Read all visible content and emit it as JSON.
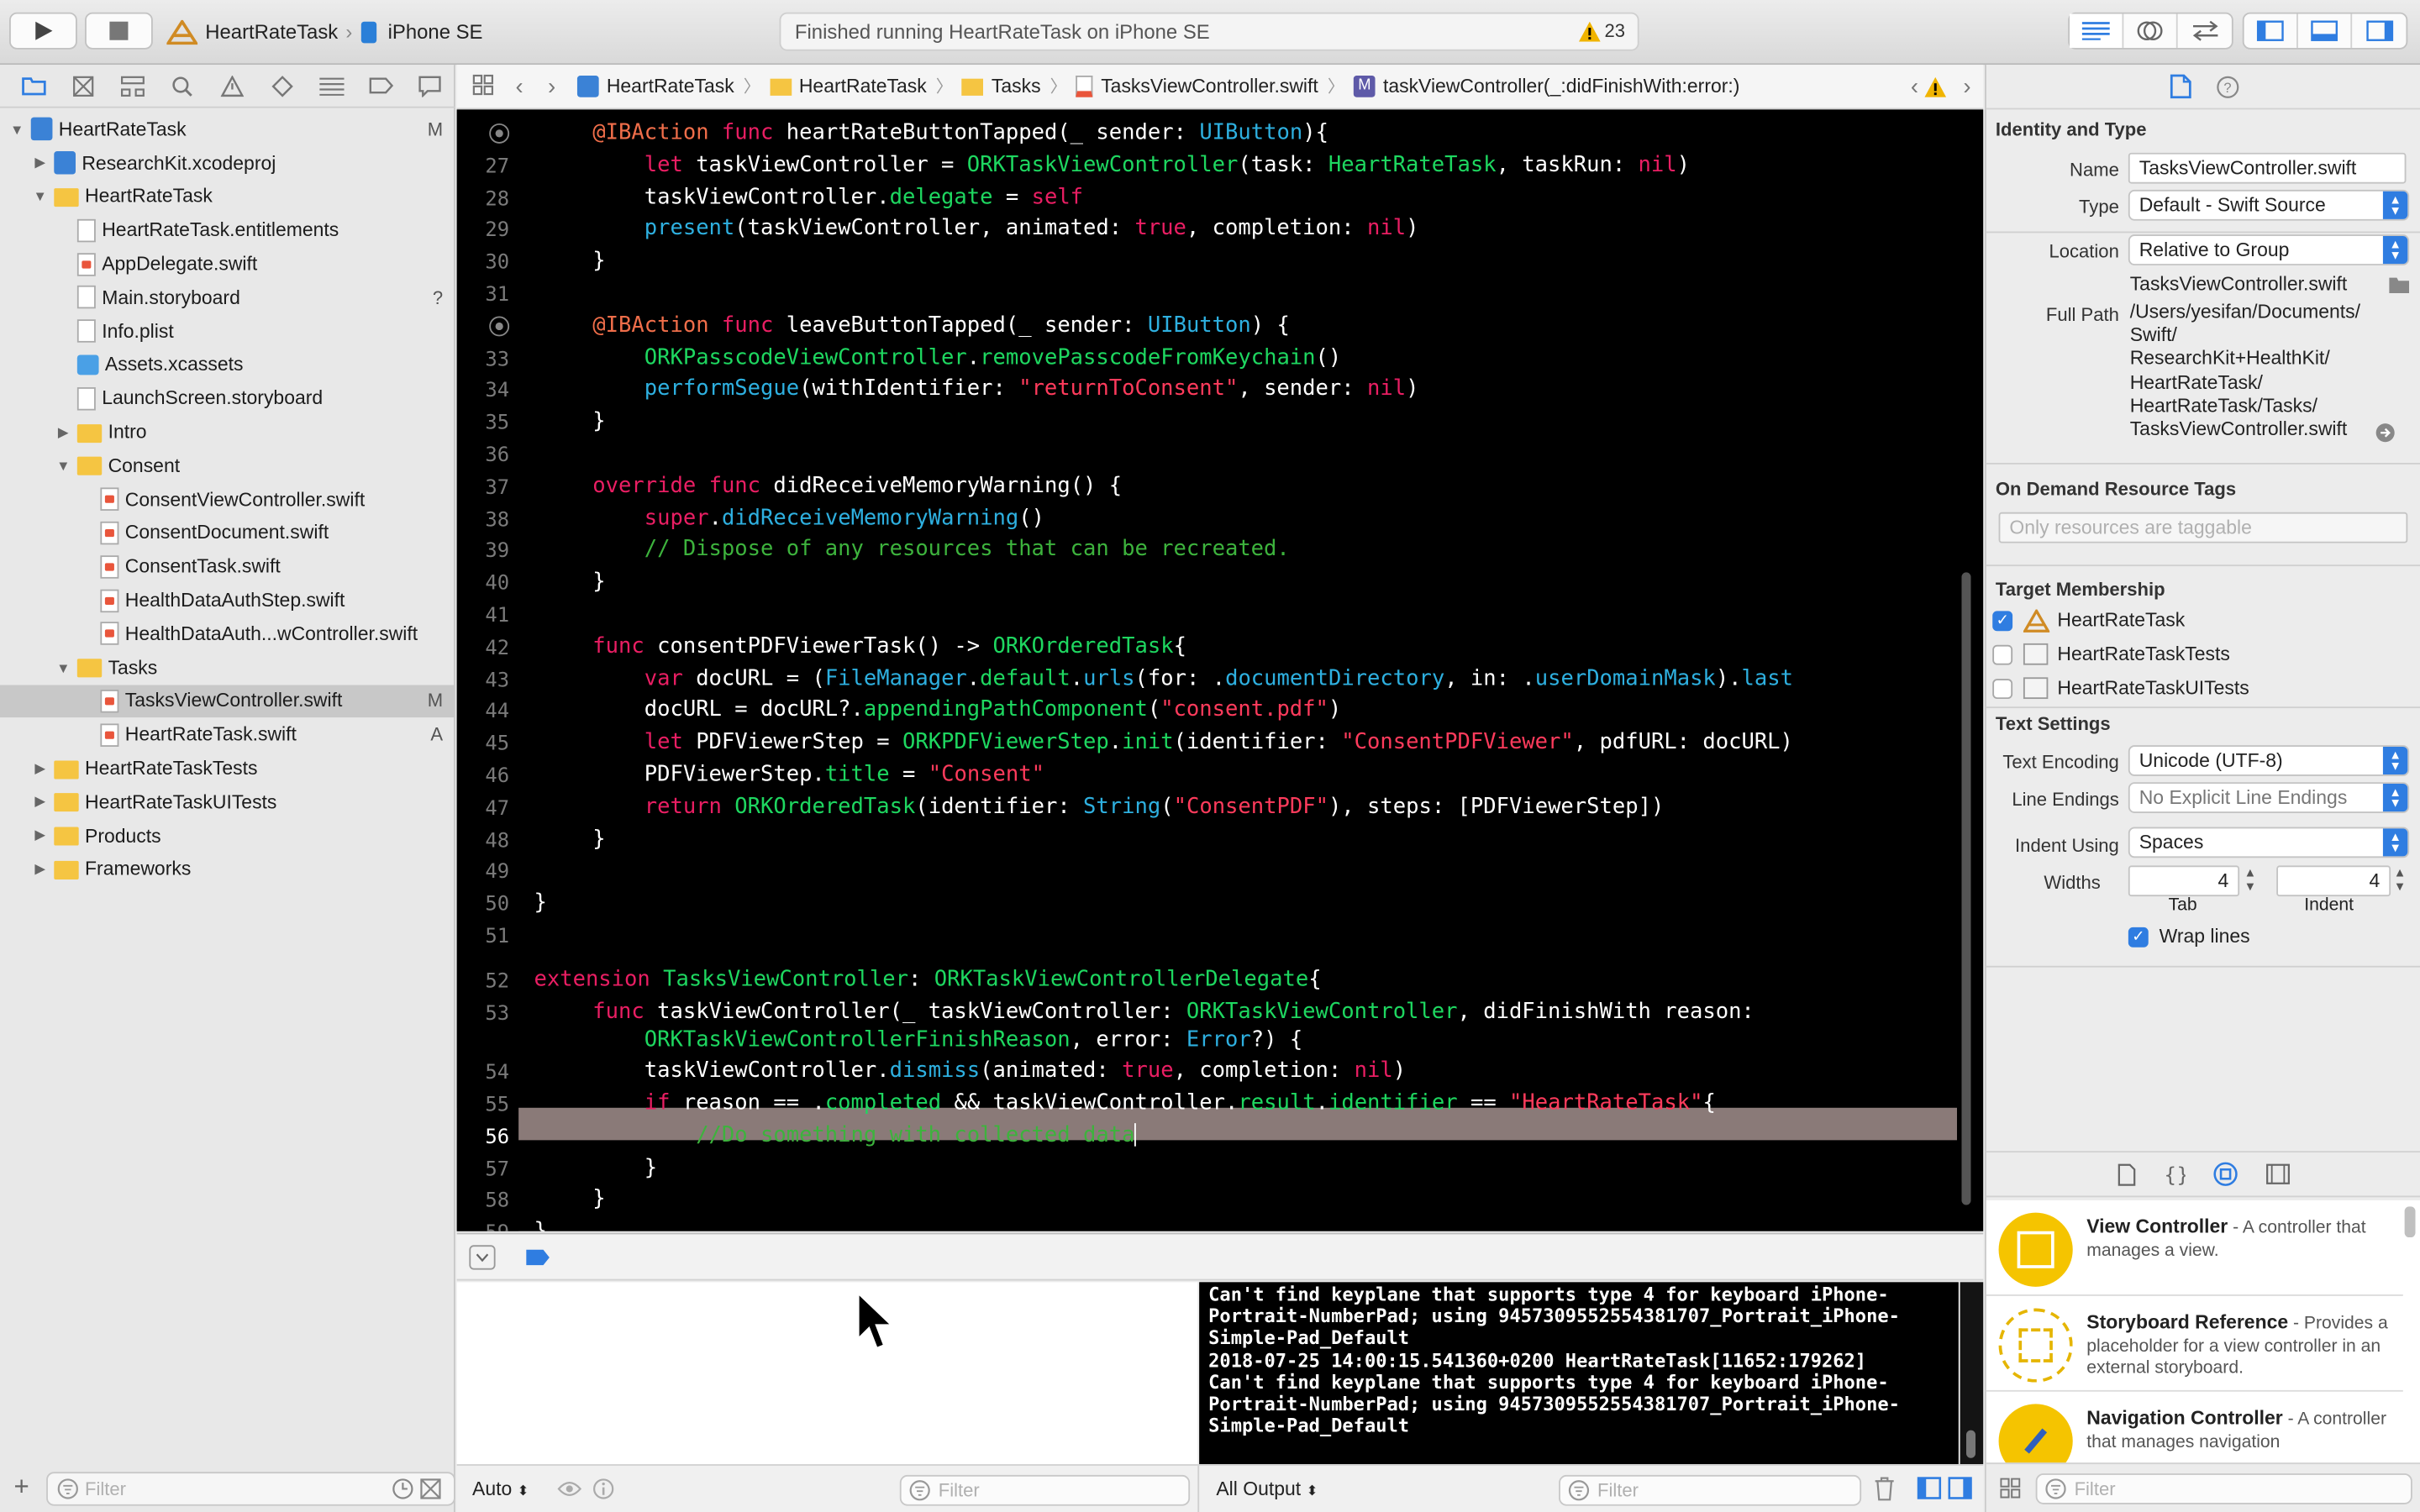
{
  "toolbar": {
    "scheme_name": "HeartRateTask",
    "device_name": "iPhone SE",
    "activity_status": "Finished running HeartRateTask on iPhone SE",
    "warning_count": "23"
  },
  "navigator": {
    "items": [
      {
        "label": "HeartRateTask",
        "status": "M",
        "indent": 0,
        "icon": "project-icon",
        "tri": "▼"
      },
      {
        "label": "ResearchKit.xcodeproj",
        "status": "",
        "indent": 1,
        "icon": "project-icon",
        "tri": "▶"
      },
      {
        "label": "HeartRateTask",
        "status": "",
        "indent": 1,
        "icon": "folder-icon",
        "tri": "▼"
      },
      {
        "label": "HeartRateTask.entitlements",
        "status": "",
        "indent": 2,
        "icon": "file-icon",
        "tri": ""
      },
      {
        "label": "AppDelegate.swift",
        "status": "",
        "indent": 2,
        "icon": "swift-file-icon",
        "tri": ""
      },
      {
        "label": "Main.storyboard",
        "status": "?",
        "indent": 2,
        "icon": "file-icon",
        "tri": ""
      },
      {
        "label": "Info.plist",
        "status": "",
        "indent": 2,
        "icon": "file-icon",
        "tri": ""
      },
      {
        "label": "Assets.xcassets",
        "status": "",
        "indent": 2,
        "icon": "assets-icon",
        "tri": ""
      },
      {
        "label": "LaunchScreen.storyboard",
        "status": "",
        "indent": 2,
        "icon": "file-icon",
        "tri": ""
      },
      {
        "label": "Intro",
        "status": "",
        "indent": 2,
        "icon": "folder-icon",
        "tri": "▶"
      },
      {
        "label": "Consent",
        "status": "",
        "indent": 2,
        "icon": "folder-icon",
        "tri": "▼"
      },
      {
        "label": "ConsentViewController.swift",
        "status": "",
        "indent": 3,
        "icon": "swift-file-icon",
        "tri": ""
      },
      {
        "label": "ConsentDocument.swift",
        "status": "",
        "indent": 3,
        "icon": "swift-file-icon",
        "tri": ""
      },
      {
        "label": "ConsentTask.swift",
        "status": "",
        "indent": 3,
        "icon": "swift-file-icon",
        "tri": ""
      },
      {
        "label": "HealthDataAuthStep.swift",
        "status": "",
        "indent": 3,
        "icon": "swift-file-icon",
        "tri": ""
      },
      {
        "label": "HealthDataAuth...wController.swift",
        "status": "",
        "indent": 3,
        "icon": "swift-file-icon",
        "tri": ""
      },
      {
        "label": "Tasks",
        "status": "",
        "indent": 2,
        "icon": "folder-icon",
        "tri": "▼"
      },
      {
        "label": "TasksViewController.swift",
        "status": "M",
        "indent": 3,
        "icon": "swift-file-icon",
        "tri": "",
        "selected": true
      },
      {
        "label": "HeartRateTask.swift",
        "status": "A",
        "indent": 3,
        "icon": "swift-file-icon",
        "tri": ""
      },
      {
        "label": "HeartRateTaskTests",
        "status": "",
        "indent": 1,
        "icon": "folder-icon",
        "tri": "▶"
      },
      {
        "label": "HeartRateTaskUITests",
        "status": "",
        "indent": 1,
        "icon": "folder-icon",
        "tri": "▶"
      },
      {
        "label": "Products",
        "status": "",
        "indent": 1,
        "icon": "folder-icon",
        "tri": "▶"
      },
      {
        "label": "Frameworks",
        "status": "",
        "indent": 1,
        "icon": "folder-icon",
        "tri": "▶"
      }
    ],
    "filter_placeholder": "Filter"
  },
  "jumpbar": {
    "crumbs": [
      "HeartRateTask",
      "HeartRateTask",
      "Tasks",
      "TasksViewController.swift",
      "taskViewController(_:didFinishWith:error:)"
    ]
  },
  "editor": {
    "lines": [
      {
        "n": "",
        "bp": true,
        "parts": [
          [
            "at",
            "@IBAction "
          ],
          [
            "kw",
            "func "
          ],
          [
            "",
            "heartRateButtonTapped(_ sender: "
          ],
          [
            "fn",
            "UIButton"
          ],
          [
            "",
            "){"
          ]
        ]
      },
      {
        "n": "27",
        "parts": [
          [
            "",
            "    "
          ],
          [
            "kw",
            "let "
          ],
          [
            "",
            "taskViewController = "
          ],
          [
            "ty",
            "ORKTaskViewController"
          ],
          [
            "",
            "(task: "
          ],
          [
            "ty",
            "HeartRateTask"
          ],
          [
            "",
            ", taskRun: "
          ],
          [
            "kw",
            "nil"
          ],
          [
            "",
            ")"
          ]
        ]
      },
      {
        "n": "28",
        "parts": [
          [
            "",
            "    taskViewController."
          ],
          [
            "ty",
            "delegate"
          ],
          [
            "",
            " = "
          ],
          [
            "kw",
            "self"
          ]
        ]
      },
      {
        "n": "29",
        "parts": [
          [
            "",
            "    "
          ],
          [
            "fn",
            "present"
          ],
          [
            "",
            "(taskViewController, animated: "
          ],
          [
            "kw",
            "true"
          ],
          [
            "",
            ", completion: "
          ],
          [
            "kw",
            "nil"
          ],
          [
            "",
            ")"
          ]
        ]
      },
      {
        "n": "30",
        "parts": [
          [
            "",
            "}"
          ]
        ]
      },
      {
        "n": "31",
        "parts": []
      },
      {
        "n": "",
        "bp": true,
        "parts": [
          [
            "at",
            "@IBAction "
          ],
          [
            "kw",
            "func "
          ],
          [
            "",
            "leaveButtonTapped(_ sender: "
          ],
          [
            "fn",
            "UIButton"
          ],
          [
            "",
            ") {"
          ]
        ]
      },
      {
        "n": "33",
        "parts": [
          [
            "",
            "    "
          ],
          [
            "ty",
            "ORKPasscodeViewController"
          ],
          [
            "",
            "."
          ],
          [
            "ty",
            "removePasscodeFromKeychain"
          ],
          [
            "",
            "()"
          ]
        ]
      },
      {
        "n": "34",
        "parts": [
          [
            "",
            "    "
          ],
          [
            "fn",
            "performSegue"
          ],
          [
            "",
            "(withIdentifier: "
          ],
          [
            "st",
            "\"returnToConsent\""
          ],
          [
            "",
            ", sender: "
          ],
          [
            "kw",
            "nil"
          ],
          [
            "",
            ")"
          ]
        ]
      },
      {
        "n": "35",
        "parts": [
          [
            "",
            "}"
          ]
        ]
      },
      {
        "n": "36",
        "parts": []
      },
      {
        "n": "37",
        "parts": [
          [
            "kw",
            "override "
          ],
          [
            "kw",
            "func "
          ],
          [
            "",
            "didReceiveMemoryWarning() {"
          ]
        ]
      },
      {
        "n": "38",
        "parts": [
          [
            "",
            "    "
          ],
          [
            "kw",
            "super"
          ],
          [
            "",
            "."
          ],
          [
            "fn",
            "didReceiveMemoryWarning"
          ],
          [
            "",
            "()"
          ]
        ]
      },
      {
        "n": "39",
        "parts": [
          [
            "cm",
            "    // Dispose of any resources that can be recreated."
          ]
        ]
      },
      {
        "n": "40",
        "parts": [
          [
            "",
            "}"
          ]
        ]
      },
      {
        "n": "41",
        "parts": []
      },
      {
        "n": "42",
        "parts": [
          [
            "kw",
            "func "
          ],
          [
            "",
            "consentPDFViewerTask() -> "
          ],
          [
            "ty",
            "ORKOrderedTask"
          ],
          [
            "",
            "{"
          ]
        ]
      },
      {
        "n": "43",
        "parts": [
          [
            "",
            "    "
          ],
          [
            "kw",
            "var "
          ],
          [
            "",
            "docURL = ("
          ],
          [
            "fn",
            "FileManager"
          ],
          [
            "",
            "."
          ],
          [
            "ty",
            "default"
          ],
          [
            "",
            "."
          ],
          [
            "fn",
            "urls"
          ],
          [
            "",
            "(for: ."
          ],
          [
            "fn",
            "documentDirectory"
          ],
          [
            "",
            ", in: ."
          ],
          [
            "fn",
            "userDomainMask"
          ],
          [
            "",
            ")."
          ],
          [
            "fn",
            "last"
          ]
        ]
      },
      {
        "n": "44",
        "parts": [
          [
            "",
            "    docURL = docURL?."
          ],
          [
            "ty",
            "appendingPathComponent"
          ],
          [
            "",
            "("
          ],
          [
            "st",
            "\"consent.pdf\""
          ],
          [
            "",
            ")"
          ]
        ]
      },
      {
        "n": "45",
        "parts": [
          [
            "",
            "    "
          ],
          [
            "kw",
            "let "
          ],
          [
            "",
            "PDFViewerStep = "
          ],
          [
            "ty",
            "ORKPDFViewerStep"
          ],
          [
            "",
            "."
          ],
          [
            "ty",
            "init"
          ],
          [
            "",
            "(identifier: "
          ],
          [
            "st",
            "\"ConsentPDFViewer\""
          ],
          [
            "",
            ", pdfURL: docURL)"
          ]
        ]
      },
      {
        "n": "46",
        "parts": [
          [
            "",
            "    PDFViewerStep."
          ],
          [
            "ty",
            "title"
          ],
          [
            "",
            " = "
          ],
          [
            "st",
            "\"Consent\""
          ]
        ]
      },
      {
        "n": "47",
        "parts": [
          [
            "",
            "    "
          ],
          [
            "kw",
            "return "
          ],
          [
            "ty",
            "ORKOrderedTask"
          ],
          [
            "",
            "(identifier: "
          ],
          [
            "fn",
            "String"
          ],
          [
            "",
            "("
          ],
          [
            "st",
            "\"ConsentPDF\""
          ],
          [
            "",
            "), steps: [PDFViewerStep])"
          ]
        ]
      },
      {
        "n": "48",
        "parts": [
          [
            "",
            "}"
          ]
        ]
      },
      {
        "n": "49",
        "parts": []
      },
      {
        "n": "50",
        "indent0": true,
        "parts": [
          [
            "",
            "}"
          ]
        ]
      },
      {
        "n": "51",
        "parts": []
      },
      {
        "n": "52",
        "indent0": true,
        "parts": [
          [
            "kw",
            "extension "
          ],
          [
            "ty",
            "TasksViewController"
          ],
          [
            "",
            ": "
          ],
          [
            "ty",
            "ORKTaskViewControllerDelegate"
          ],
          [
            "",
            "{"
          ]
        ]
      },
      {
        "n": "53",
        "parts": [
          [
            "kw",
            "func "
          ],
          [
            "",
            "taskViewController(_ taskViewController: "
          ],
          [
            "ty",
            "ORKTaskViewController"
          ],
          [
            "",
            ", didFinishWith reason:"
          ]
        ]
      },
      {
        "n": "",
        "parts": [
          [
            "",
            "    "
          ],
          [
            "ty",
            "ORKTaskViewControllerFinishReason"
          ],
          [
            "",
            ", error: "
          ],
          [
            "fn",
            "Error"
          ],
          [
            "",
            "?) {"
          ]
        ]
      },
      {
        "n": "54",
        "parts": [
          [
            "",
            "    taskViewController."
          ],
          [
            "fn",
            "dismiss"
          ],
          [
            "",
            "(animated: "
          ],
          [
            "kw",
            "true"
          ],
          [
            "",
            ", completion: "
          ],
          [
            "kw",
            "nil"
          ],
          [
            "",
            ")"
          ]
        ]
      },
      {
        "n": "55",
        "parts": [
          [
            "",
            "    "
          ],
          [
            "kw",
            "if "
          ],
          [
            "",
            "reason == ."
          ],
          [
            "ty",
            "completed"
          ],
          [
            "",
            " && taskViewController."
          ],
          [
            "ty",
            "result"
          ],
          [
            "",
            "."
          ],
          [
            "ty",
            "identifier"
          ],
          [
            "",
            " == "
          ],
          [
            "st",
            "\"HeartRateTask\""
          ],
          [
            "",
            "{"
          ]
        ]
      },
      {
        "n": "56",
        "highlight": true,
        "parts": [
          [
            "cm",
            "        //Do something with collected data"
          ]
        ]
      },
      {
        "n": "57",
        "parts": [
          [
            "",
            "    }"
          ]
        ]
      },
      {
        "n": "58",
        "parts": [
          [
            "",
            "}"
          ]
        ]
      },
      {
        "n": "59",
        "indent0": true,
        "parts": [
          [
            "",
            "}"
          ]
        ]
      }
    ]
  },
  "debug": {
    "console_lines": [
      "Can't find keyplane that supports type 4 for keyboard iPhone-",
      "Portrait-NumberPad; using 9457309552554381707_Portrait_iPhone-",
      "Simple-Pad_Default",
      "2018-07-25 14:00:15.541360+0200 HeartRateTask[11652:179262]",
      "Can't find keyplane that supports type 4 for keyboard iPhone-",
      "Portrait-NumberPad; using 9457309552554381707_Portrait_iPhone-",
      "Simple-Pad_Default"
    ],
    "vars_mode": "Auto",
    "vars_filter_placeholder": "Filter",
    "output_mode": "All Output",
    "console_filter_placeholder": "Filter"
  },
  "inspector": {
    "identity_header": "Identity and Type",
    "name_label": "Name",
    "name_value": "TasksViewController.swift",
    "type_label": "Type",
    "type_value": "Default - Swift Source",
    "location_label": "Location",
    "location_value": "Relative to Group",
    "location_file": "TasksViewController.swift",
    "fullpath_label": "Full Path",
    "fullpath_lines": [
      "/Users/yesifan/Documents/",
      "Swift/",
      "ResearchKit+HealthKit/",
      "HeartRateTask/",
      "HeartRateTask/Tasks/",
      "TasksViewController.swift"
    ],
    "odr_header": "On Demand Resource Tags",
    "odr_placeholder": "Only resources are taggable",
    "target_header": "Target Membership",
    "targets": [
      {
        "label": "HeartRateTask",
        "checked": true
      },
      {
        "label": "HeartRateTaskTests",
        "checked": false
      },
      {
        "label": "HeartRateTaskUITests",
        "checked": false
      }
    ],
    "text_header": "Text Settings",
    "encoding_label": "Text Encoding",
    "encoding_value": "Unicode (UTF-8)",
    "endings_label": "Line Endings",
    "endings_value": "No Explicit Line Endings",
    "indent_label": "Indent Using",
    "indent_value": "Spaces",
    "widths_label": "Widths",
    "tab_width": "4",
    "indent_width": "4",
    "tab_caption": "Tab",
    "indent_caption": "Indent",
    "wrap_label": "Wrap lines",
    "library": [
      {
        "title": "View Controller",
        "desc": " - A controller that manages a view."
      },
      {
        "title": "Storyboard Reference",
        "desc": " - Provides a placeholder for a view controller in an external storyboard."
      },
      {
        "title": "Navigation Controller",
        "desc": " - A controller that manages navigation"
      }
    ],
    "library_filter_placeholder": "Filter"
  },
  "colors": {
    "accent": "#2f7de1",
    "keyword": "#e91e63",
    "type": "#1ed760",
    "function": "#2eb0e0",
    "string": "#ff3b5c",
    "comment": "#3db33d"
  }
}
